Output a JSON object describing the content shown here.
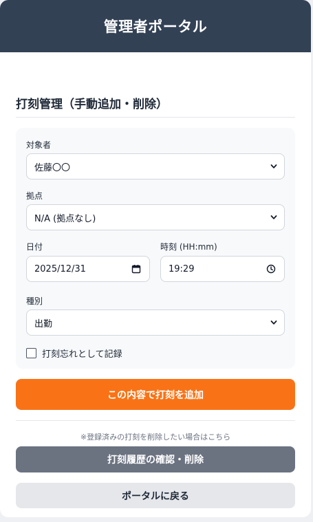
{
  "header": {
    "title": "管理者ポータル"
  },
  "section": {
    "title": "打刻管理（手動追加・削除）"
  },
  "form": {
    "target": {
      "label": "対象者",
      "value": "佐藤〇〇"
    },
    "location": {
      "label": "拠点",
      "value": "N/A (拠点なし)"
    },
    "date": {
      "label": "日付",
      "value": "2025/12/31"
    },
    "time": {
      "label": "時刻 (HH:mm)",
      "value": "19:29"
    },
    "kind": {
      "label": "種別",
      "value": "出勤"
    },
    "forgot": {
      "label": "打刻忘れとして記録",
      "checked": false
    }
  },
  "actions": {
    "add_label": "この内容で打刻を追加",
    "note": "※登録済みの打刻を削除したい場合はこちら",
    "history_label": "打刻履歴の確認・削除",
    "back_label": "ポータルに戻る"
  },
  "colors": {
    "header_bg": "#334155",
    "primary": "#f97316",
    "secondary": "#6b7280",
    "light": "#e5e7eb"
  },
  "icons": {
    "select": "chevron-down-icon",
    "date": "calendar-icon",
    "time": "clock-icon"
  }
}
